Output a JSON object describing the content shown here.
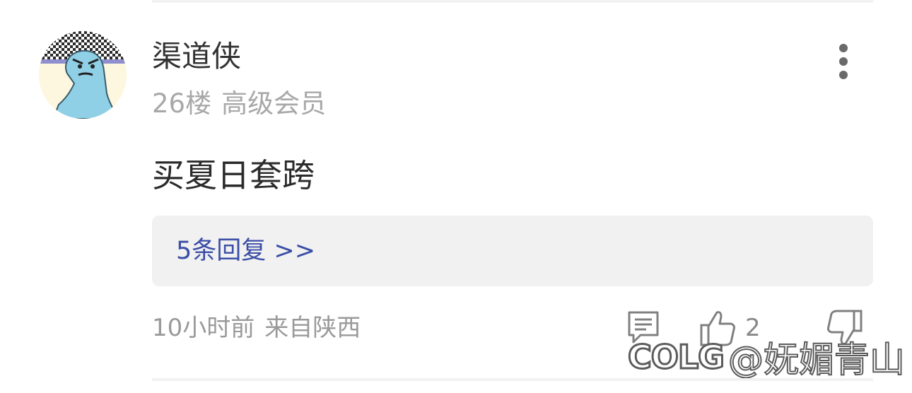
{
  "comment": {
    "author": "渠道侠",
    "floor": "26楼",
    "member_level": "高级会员",
    "text": "买夏日套跨",
    "replies_label": "5条回复 >>",
    "time_ago": "10小时前",
    "location": "来自陕西",
    "like_count": "2"
  },
  "watermark": {
    "logo": "COLG",
    "user": "@妩媚青山"
  },
  "icons": {
    "more": "more-vertical-icon",
    "comment": "comment-icon",
    "like": "thumbs-up-icon",
    "dislike": "thumbs-down-icon"
  },
  "colors": {
    "link": "#3b4ea6",
    "reply_box_bg": "#f1f1f1",
    "meta_text": "#a8a8a8"
  }
}
